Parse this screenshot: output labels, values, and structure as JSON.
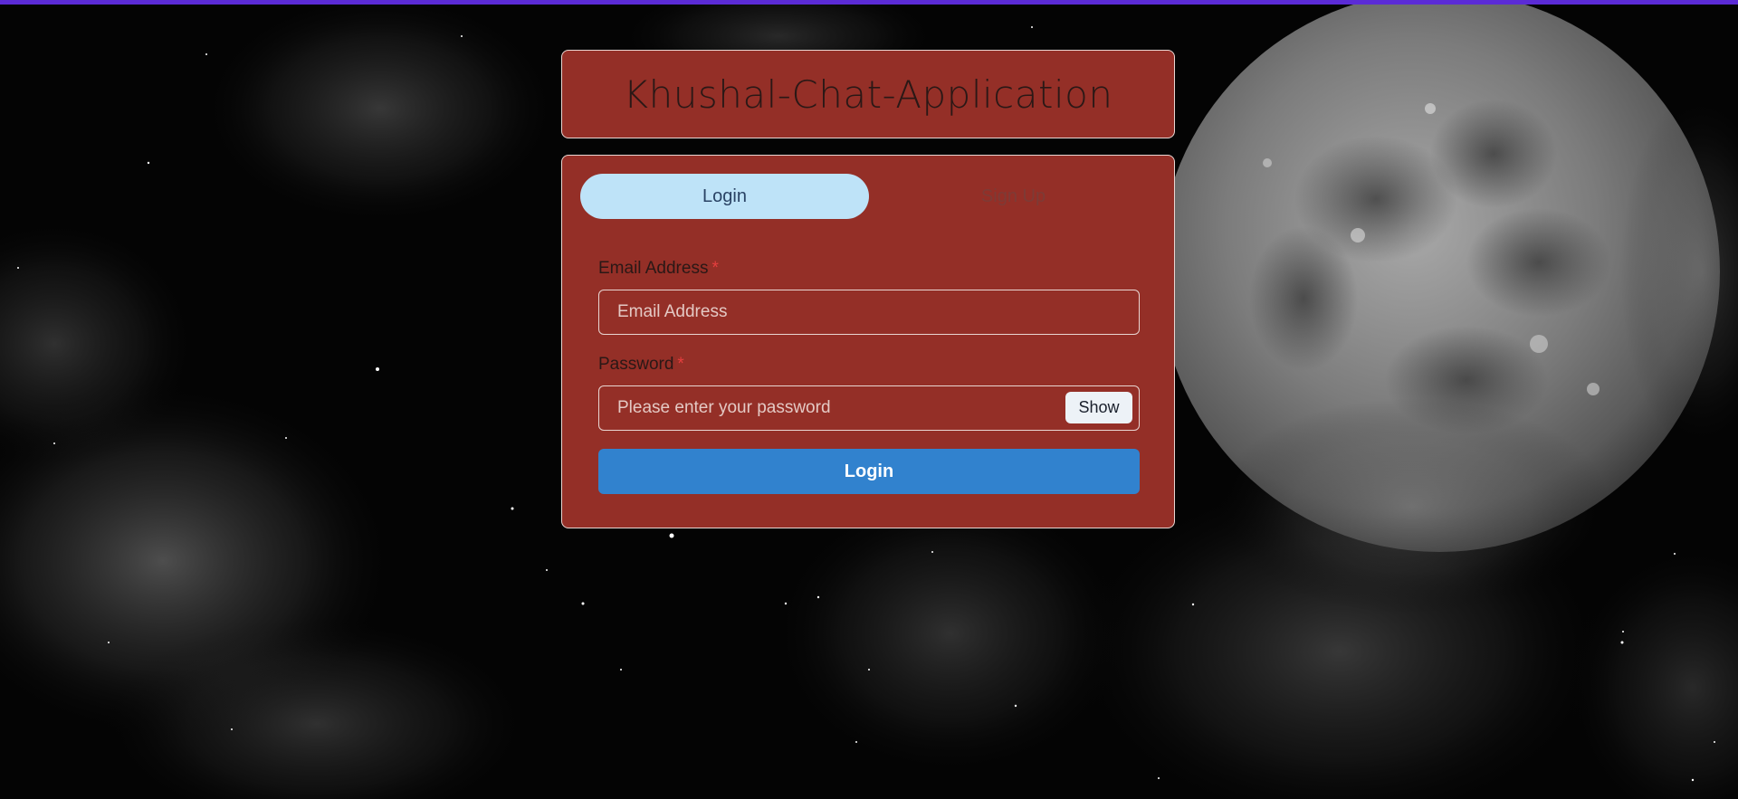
{
  "app": {
    "title": "Khushal-Chat-Application"
  },
  "tabs": [
    {
      "label": "Login",
      "active": true
    },
    {
      "label": "Sign Up",
      "active": false
    }
  ],
  "form": {
    "email_label": "Email Address",
    "email_placeholder": "Email Address",
    "email_value": "",
    "password_label": "Password",
    "password_placeholder": "Please enter your password",
    "password_value": "",
    "required_marker": "*",
    "show_label": "Show",
    "submit_label": "Login"
  },
  "colors": {
    "accent_bar": "#5b2bd6",
    "card_bg": "#942f27",
    "tab_active_bg": "#bee3f8",
    "primary_button": "#3182ce",
    "required": "#e53e3e"
  }
}
